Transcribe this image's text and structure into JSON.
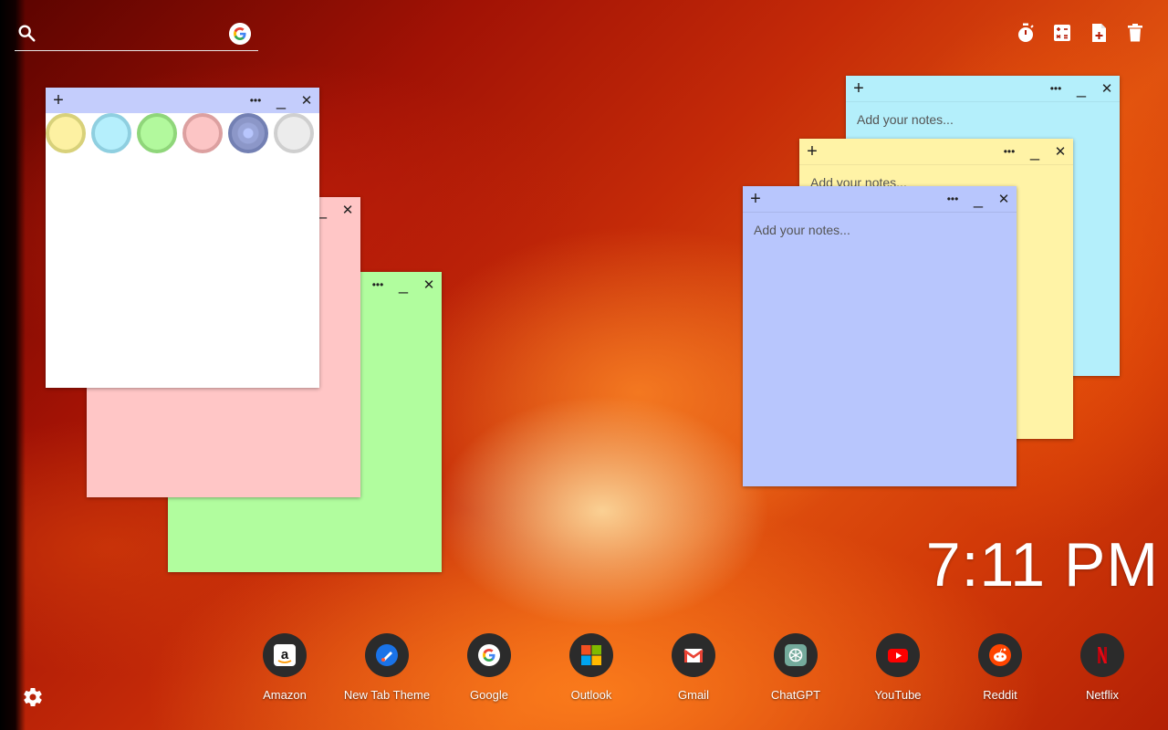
{
  "search": {
    "placeholder": "",
    "value": ""
  },
  "toolbar": {
    "tools": [
      {
        "icon": "timer-icon"
      },
      {
        "icon": "calculator-icon"
      },
      {
        "icon": "add-note-icon"
      },
      {
        "icon": "trash-icon"
      }
    ]
  },
  "notes": {
    "add_symbol": "+",
    "more_symbol": "•••",
    "minimize_symbol": "_",
    "close_symbol": "✕",
    "placeholder": "Add your notes...",
    "colors": {
      "white": "#ffffff",
      "pink": "#ffc6c6",
      "green": "#b1fd9e",
      "cyan": "#b4effb",
      "yellow": "#fff3a6",
      "blue": "#b8c6fd",
      "bar_white": "#c4cdfc",
      "bar_cyan": "#b4effb",
      "bar_yellow": "#fff3a6",
      "bar_blue": "#b8c6fd"
    },
    "swatches": [
      {
        "name": "yellow",
        "fill": "#fdf1a2",
        "ring": "#d8d17a"
      },
      {
        "name": "cyan",
        "fill": "#b5effc",
        "ring": "#8fcfe0"
      },
      {
        "name": "green",
        "fill": "#b2f99d",
        "ring": "#8fd67a"
      },
      {
        "name": "pink",
        "fill": "#fcc5c5",
        "ring": "#dca0a0"
      },
      {
        "name": "blue",
        "fill": "#8c97c8",
        "ring": "#7380b3",
        "selected": true
      },
      {
        "name": "gray",
        "fill": "#ececec",
        "ring": "#cfcfcf"
      }
    ]
  },
  "clock": {
    "time": "7:11 PM"
  },
  "shortcuts": [
    {
      "label": "Amazon",
      "icon": "amazon-icon"
    },
    {
      "label": "New Tab Theme",
      "icon": "new-tab-theme-icon"
    },
    {
      "label": "Google",
      "icon": "google-icon"
    },
    {
      "label": "Outlook",
      "icon": "outlook-icon"
    },
    {
      "label": "Gmail",
      "icon": "gmail-icon"
    },
    {
      "label": "ChatGPT",
      "icon": "chatgpt-icon"
    },
    {
      "label": "YouTube",
      "icon": "youtube-icon"
    },
    {
      "label": "Reddit",
      "icon": "reddit-icon"
    },
    {
      "label": "Netflix",
      "icon": "netflix-icon"
    }
  ],
  "settings": {
    "icon": "gear-icon"
  }
}
